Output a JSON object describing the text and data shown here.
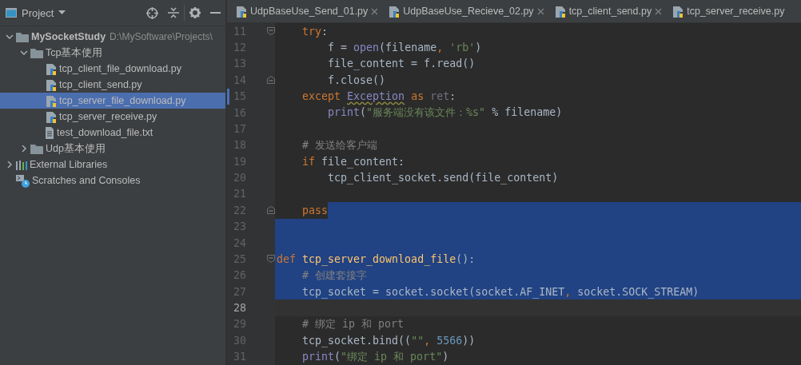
{
  "project_panel": {
    "title": "Project",
    "tree": [
      {
        "label": "MySocketStudy",
        "path": "D:\\MySoftware\\Projects\\",
        "kind": "folder",
        "expanded": true,
        "selected": false,
        "children": [
          {
            "label": "Tcp基本使用",
            "kind": "folder",
            "expanded": true,
            "selected": false,
            "children": [
              {
                "label": "tcp_client_file_download.py",
                "kind": "python",
                "selected": false
              },
              {
                "label": "tcp_client_send.py",
                "kind": "python",
                "selected": false
              },
              {
                "label": "tcp_server_file_download.py",
                "kind": "python",
                "selected": true
              },
              {
                "label": "tcp_server_receive.py",
                "kind": "python",
                "selected": false
              },
              {
                "label": "test_download_file.txt",
                "kind": "text",
                "selected": false
              }
            ]
          },
          {
            "label": "Udp基本使用",
            "kind": "folder",
            "expanded": false,
            "selected": false
          }
        ]
      },
      {
        "label": "External Libraries",
        "kind": "libraries",
        "expanded": false,
        "selected": false
      },
      {
        "label": "Scratches and Consoles",
        "kind": "scratches",
        "selected": false
      }
    ]
  },
  "tabs": [
    {
      "label": "UdpBaseUse_Send_01.py",
      "selected": false,
      "closable": true
    },
    {
      "label": "UdpBaseUse_Recieve_02.py",
      "selected": false,
      "closable": true
    },
    {
      "label": "tcp_client_send.py",
      "selected": false,
      "closable": true
    },
    {
      "label": "tcp_server_receive.py",
      "selected": false,
      "closable": false
    }
  ],
  "editor": {
    "lines": [
      {
        "number": "11",
        "fold_start": true,
        "tokens": [
          {
            "kind": "keyword",
            "text": "    try"
          },
          {
            "kind": "plain",
            "text": ":"
          }
        ]
      },
      {
        "number": "12",
        "tokens": [
          {
            "kind": "plain",
            "text": "        f = "
          },
          {
            "kind": "builtin",
            "text": "open"
          },
          {
            "kind": "plain",
            "text": "(filename"
          },
          {
            "kind": "keyword",
            "text": ", "
          },
          {
            "kind": "string",
            "text": "'rb'"
          },
          {
            "kind": "plain",
            "text": ")"
          }
        ]
      },
      {
        "number": "13",
        "tokens": [
          {
            "kind": "plain",
            "text": "        file_content = f.read()"
          }
        ]
      },
      {
        "number": "14",
        "fold_end": true,
        "tokens": [
          {
            "kind": "plain",
            "text": "        f.close()"
          }
        ]
      },
      {
        "number": "15",
        "changed": true,
        "tokens": [
          {
            "kind": "keyword",
            "text": "    except "
          },
          {
            "kind": "warning",
            "text": "Exception"
          },
          {
            "kind": "keyword",
            "text": " as "
          },
          {
            "kind": "unused",
            "text": "ret"
          },
          {
            "kind": "plain",
            "text": ":"
          }
        ]
      },
      {
        "number": "16",
        "tokens": [
          {
            "kind": "builtin",
            "text": "        print"
          },
          {
            "kind": "plain",
            "text": "("
          },
          {
            "kind": "string",
            "text": "\"服务端没有该文件：%s\""
          },
          {
            "kind": "plain",
            "text": " % filename)"
          }
        ]
      },
      {
        "number": "17"
      },
      {
        "number": "18",
        "tokens": [
          {
            "kind": "comment",
            "text": "    # 发送给客户端"
          }
        ]
      },
      {
        "number": "19",
        "tokens": [
          {
            "kind": "keyword",
            "text": "    if "
          },
          {
            "kind": "plain",
            "text": "file_content:"
          }
        ]
      },
      {
        "number": "20",
        "tokens": [
          {
            "kind": "plain",
            "text": "        tcp_client_socket.send(file_content)"
          }
        ]
      },
      {
        "number": "21"
      },
      {
        "number": "22",
        "fold_end": true,
        "selected_after": true,
        "tokens": [
          {
            "kind": "keyword",
            "text": "    pass"
          }
        ]
      },
      {
        "number": "23",
        "selected": true
      },
      {
        "number": "24",
        "selected": true
      },
      {
        "number": "25",
        "fold_start": true,
        "selected": true,
        "tokens": [
          {
            "kind": "keyword",
            "text": "def "
          },
          {
            "kind": "function",
            "text": "tcp_server_download_file"
          },
          {
            "kind": "plain",
            "text": "():"
          }
        ]
      },
      {
        "number": "26",
        "selected": true,
        "tokens": [
          {
            "kind": "comment",
            "text": "    # 创建套接字"
          }
        ]
      },
      {
        "number": "27",
        "selected": true,
        "tokens": [
          {
            "kind": "plain",
            "text": "    tcp_socket = socket.socket(socket.AF_INET"
          },
          {
            "kind": "keyword",
            "text": ", "
          },
          {
            "kind": "plain",
            "text": "socket.SOCK_STREAM)"
          }
        ]
      },
      {
        "number": "28",
        "current": true
      },
      {
        "number": "29",
        "tokens": [
          {
            "kind": "comment",
            "text": "    # 绑定 ip 和 port"
          }
        ]
      },
      {
        "number": "30",
        "tokens": [
          {
            "kind": "plain",
            "text": "    tcp_socket.bind(("
          },
          {
            "kind": "string",
            "text": "\"\""
          },
          {
            "kind": "keyword",
            "text": ", "
          },
          {
            "kind": "number",
            "text": "5566"
          },
          {
            "kind": "plain",
            "text": "))"
          }
        ]
      },
      {
        "number": "31",
        "tokens": [
          {
            "kind": "builtin",
            "text": "    print"
          },
          {
            "kind": "plain",
            "text": "("
          },
          {
            "kind": "string",
            "text": "\"绑定 ip 和 port\""
          },
          {
            "kind": "plain",
            "text": ")"
          }
        ]
      }
    ]
  }
}
